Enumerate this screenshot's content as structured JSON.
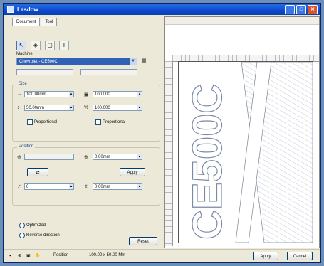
{
  "window": {
    "title": "Lasdow"
  },
  "tabs": [
    "Document",
    "Tool"
  ],
  "toolbar": {
    "tools": [
      "arrow-tool-icon",
      "node-tool-icon",
      "rect-tool-icon",
      "text-tool-icon"
    ]
  },
  "profile": {
    "label": "Machine",
    "selected": "Chevrolet - CE500C"
  },
  "dimensions": {
    "title": "Size",
    "width_value": "100.00mm",
    "height_value": "50.00mm",
    "width2_value": "100.000",
    "height2_value": "100.000",
    "option1": "Proportional",
    "option2": "Proportional"
  },
  "position": {
    "title": "Position",
    "x_value": "0.00mm",
    "apply_label": "Apply",
    "angle_value": "0",
    "angle2_value": "0.00mm"
  },
  "options": {
    "item1": "Optimized",
    "item2": "Reverse direction",
    "reset_label": "Reset"
  },
  "preview": {
    "text": "CE500C"
  },
  "status": {
    "coord": "Position",
    "size": "100.00 x 50.00 Mm",
    "ok_label": "Apply",
    "cancel_label": "Cancel"
  }
}
